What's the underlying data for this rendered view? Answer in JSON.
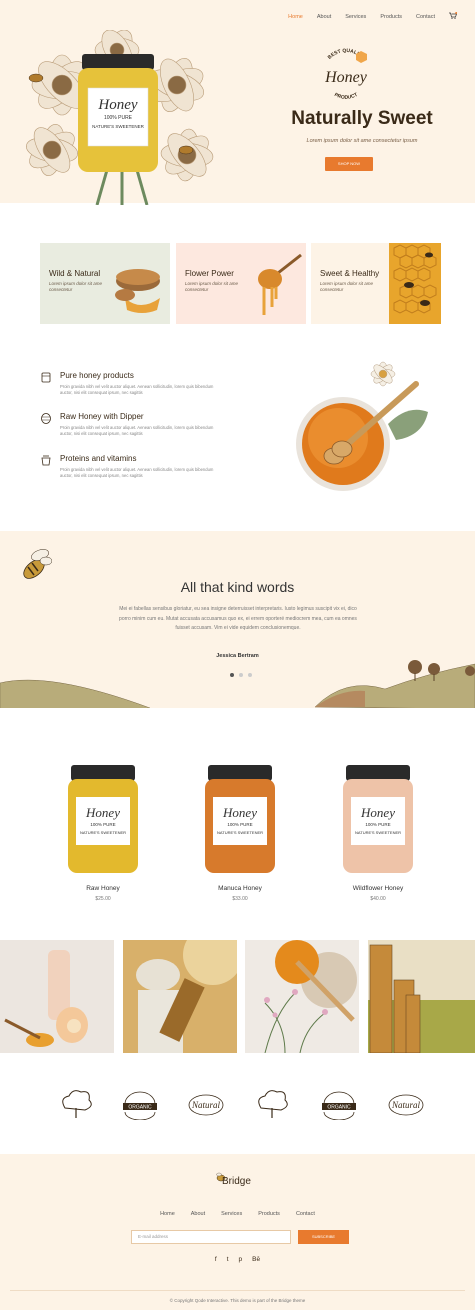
{
  "nav": {
    "items": [
      "Home",
      "About",
      "Services",
      "Products",
      "Contact"
    ],
    "active": "Home",
    "cart_icon": "cart-icon"
  },
  "hero": {
    "badge_top": "BEST QUALITY",
    "badge_word": "Honey",
    "badge_bottom": "PRODUCT",
    "jar_brand": "Honey",
    "jar_tag": "100% PURE",
    "jar_sub": "NATURE'S SWEETENER",
    "title": "Naturally Sweet",
    "subtitle": "Lorem ipsum dolor sit ame consectetur ipsum",
    "button": "SHOP NOW"
  },
  "cards": [
    {
      "title": "Wild & Natural",
      "desc": "Lorem ipsum dolor sit ame consectetur",
      "bg": "#e9ece0"
    },
    {
      "title": "Flower Power",
      "desc": "Lorem ipsum dolor sit ame consectetur",
      "bg": "#fde8df"
    },
    {
      "title": "Sweet & Healthy",
      "desc": "Lorem ipsum dolor sit ame consectetur",
      "bg": "#fdf3e6"
    }
  ],
  "features": [
    {
      "title": "Pure honey products",
      "icon": "honey-jar-icon",
      "desc": "Proin gravida nibh vel velit auctor aliquet. Aenean sollicitudin, lorem quis bibendum auctor, nisi elit consequat ipsum, nec sagittis"
    },
    {
      "title": "Raw Honey with Dipper",
      "icon": "beehive-icon",
      "desc": "Proin gravida nibh vel velit auctor aliquet. Aenean sollicitudin, lorem quis bibendum auctor, nisi elit consequat ipsum, nec sagittis"
    },
    {
      "title": "Proteins and vitamins",
      "icon": "honey-pot-icon",
      "desc": "Proin gravida nibh vel velit auctor aliquet. Aenean sollicitudin, lorem quis bibendum auctor, nisi elit consequat ipsum, nec sagittis"
    }
  ],
  "testimonials": {
    "title": "All that kind words",
    "text": "Mei ei fabellas sensibus gloriatur, eu sea insigne deterruisset interpretaris. Iusto legimus suscipit vix ei, dico porro minim cum eu. Mutat accusata accusamus quo ex, ei errem oporteré mediocrem mea, cum ea omnes fuisset accusam. Vim ei vide equidem conclusionemque.",
    "author": "Jessica Bertram",
    "slides": 3,
    "active_slide": 1
  },
  "products": [
    {
      "name": "Raw Honey",
      "price": "$25.00",
      "jar_color": "#e3b92d",
      "label": "Honey",
      "tag": "100% PURE",
      "sub": "NATURE'S SWEETENER"
    },
    {
      "name": "Manuca Honey",
      "price": "$33.00",
      "jar_color": "#d77a2c",
      "label": "Honey",
      "tag": "100% PURE",
      "sub": "NATURE'S SWEETENER"
    },
    {
      "name": "Wildflower Honey",
      "price": "$40.00",
      "jar_color": "#eec3a8",
      "label": "Honey",
      "tag": "100% PURE",
      "sub": "NATURE'S SWEETENER"
    }
  ],
  "logos": [
    {
      "icon": "tree-logo-icon"
    },
    {
      "icon": "organic-logo-icon",
      "text": "ORGANIC"
    },
    {
      "icon": "natural-logo-icon",
      "text": "Natural"
    },
    {
      "icon": "tree-logo-icon"
    },
    {
      "icon": "organic-logo-icon",
      "text": "ORGANIC"
    },
    {
      "icon": "natural-logo-icon",
      "text": "Natural"
    }
  ],
  "footer": {
    "logo": "Bridge",
    "nav": [
      "Home",
      "About",
      "Services",
      "Products",
      "Contact"
    ],
    "email_placeholder": "E-mail address",
    "subscribe": "SUBSCRIBE",
    "social": [
      "f",
      "t",
      "p",
      "Bē"
    ],
    "copyright": "© Copyright Qode Interactive. This demo is part of the Bridge theme"
  },
  "colors": {
    "accent": "#e87a2e",
    "cream": "#fdf3e6",
    "brown": "#3a2a18"
  }
}
